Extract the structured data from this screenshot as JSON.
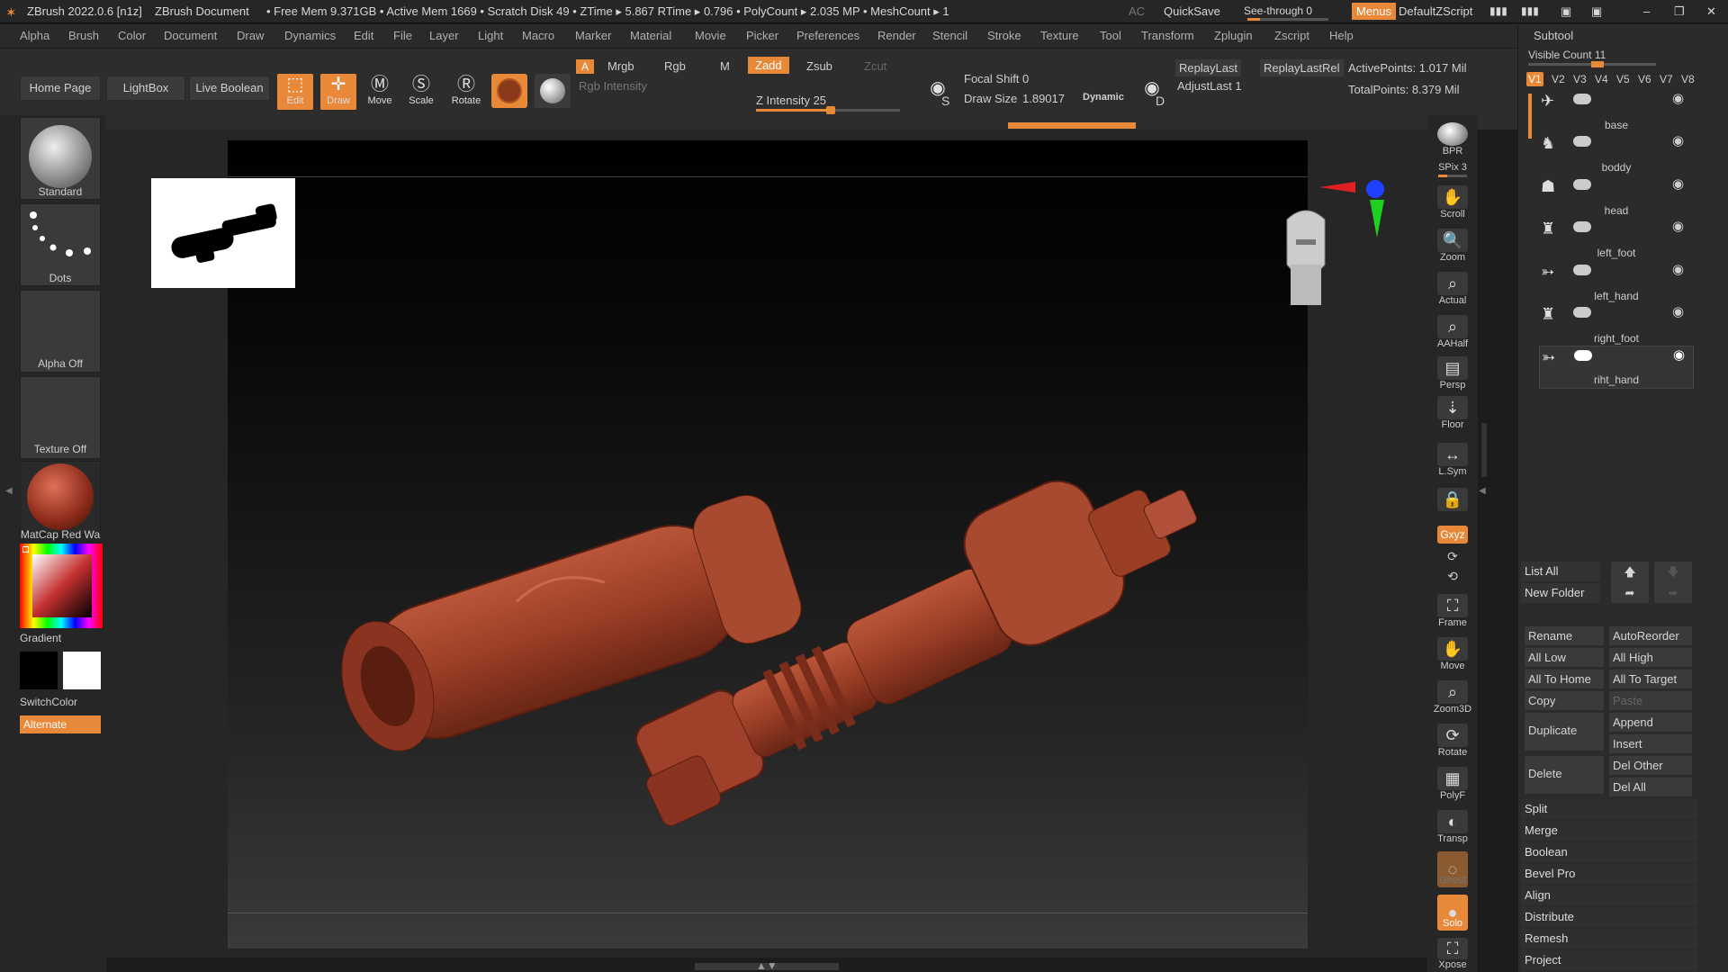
{
  "titlebar": {
    "app": "ZBrush 2022.0.6 [n1z]",
    "document": "ZBrush Document",
    "stats": "• Free Mem 9.371GB • Active Mem 1669 • Scratch Disk 49 • ZTime ▸ 5.867 RTime ▸ 0.796 • PolyCount ▸ 2.035 MP • MeshCount ▸ 1",
    "ac": "AC",
    "quicksave": "QuickSave",
    "seethrough": "See-through 0",
    "menus": "Menus",
    "script": "DefaultZScript"
  },
  "menu": [
    "Alpha",
    "Brush",
    "Color",
    "Document",
    "Draw",
    "Dynamics",
    "Edit",
    "File",
    "Layer",
    "Light",
    "Macro",
    "Marker",
    "Material",
    "Movie",
    "Picker",
    "Preferences",
    "Render",
    "Stencil",
    "Stroke",
    "Texture",
    "Tool",
    "Transform",
    "Zplugin",
    "Zscript",
    "Help"
  ],
  "toolbar": {
    "home": "Home Page",
    "lightbox": "LightBox",
    "liveboolean": "Live Boolean",
    "edit": "Edit",
    "draw": "Draw",
    "move": "Move",
    "scale": "Scale",
    "rotate": "Rotate",
    "a": "A",
    "mrgb": "Mrgb",
    "rgb": "Rgb",
    "m": "M",
    "zadd": "Zadd",
    "zsub": "Zsub",
    "zcut": "Zcut",
    "rgb_intensity": "Rgb Intensity",
    "z_intensity": "Z Intensity 25",
    "focal_shift": "Focal Shift 0",
    "draw_size": "Draw Size",
    "draw_size_value": "1.89017",
    "dynamic": "Dynamic",
    "replaylast": "ReplayLast",
    "replaylastrel": "ReplayLastRel",
    "adjustlast": "AdjustLast 1",
    "activepoints": "ActivePoints: 1.017 Mil",
    "totalpoints": "TotalPoints: 8.379 Mil",
    "s": "S",
    "d": "D"
  },
  "leftshelf": {
    "brush": "Standard",
    "stroke": "Dots",
    "alpha": "Alpha Off",
    "texture": "Texture Off",
    "material": "MatCap Red Wa",
    "gradient": "Gradient",
    "switchcolor": "SwitchColor",
    "alternate": "Alternate"
  },
  "rightshelf": [
    "BPR",
    "SPix 3",
    "Scroll",
    "Zoom",
    "Actual",
    "AAHalf",
    "Persp",
    "Floor",
    "L.Sym",
    "",
    "Gxyz",
    "",
    "",
    "Frame",
    "Move",
    "Zoom3D",
    "Rotate",
    "PolyF",
    "Transp",
    "Ghost",
    "Solo",
    "Xpose"
  ],
  "subtool": {
    "title": "Subtool",
    "visible_count": "Visible Count 11",
    "versions": [
      "V1",
      "V2",
      "V3",
      "V4",
      "V5",
      "V6",
      "V7",
      "V8"
    ],
    "items": [
      "base",
      "boddy",
      "head",
      "left_foot",
      "left_hand",
      "right_foot",
      "riht_hand"
    ],
    "list_all": "List All",
    "new_folder": "New Folder",
    "rename": "Rename",
    "autoreorder": "AutoReorder",
    "all_low": "All Low",
    "all_high": "All High",
    "all_to_home": "All To Home",
    "all_to_target": "All To Target",
    "copy": "Copy",
    "paste": "Paste",
    "duplicate": "Duplicate",
    "append": "Append",
    "insert": "Insert",
    "delete": "Delete",
    "del_other": "Del Other",
    "del_all": "Del All",
    "sections": [
      "Split",
      "Merge",
      "Boolean",
      "Bevel Pro",
      "Align",
      "Distribute",
      "Remesh",
      "Project"
    ]
  },
  "colors": {
    "accent": "#e8893a",
    "model": "#a8452c"
  }
}
